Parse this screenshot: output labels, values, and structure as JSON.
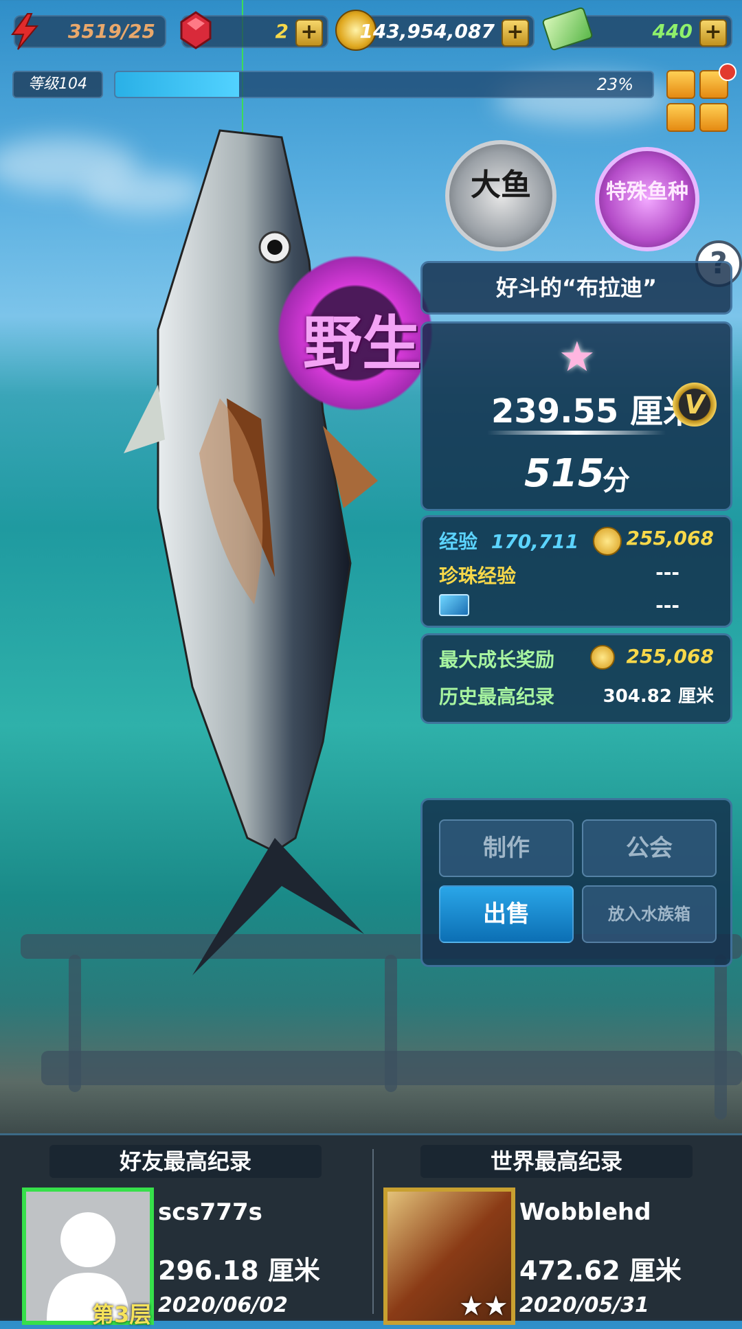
{
  "topbar": {
    "energy": "3519/25",
    "gems": "2",
    "coins": "143,954,087",
    "cash": "440",
    "plus_symbol": "+"
  },
  "level": {
    "label": "等级104",
    "progress_text": "23%",
    "progress_fraction": 0.23
  },
  "badges": {
    "big_fish": "大鱼",
    "special_species": "特殊鱼种",
    "help": "?"
  },
  "wild_label": "野生",
  "fish": {
    "name": "好斗的“布拉迪”",
    "size_value": "239.55",
    "size_unit": "厘米",
    "vip_letter": "V",
    "score_value": "515",
    "score_unit": "分"
  },
  "rewards": {
    "exp_label": "经验",
    "exp_value": "170,711",
    "coin_value": "255,068",
    "pearl_exp_label": "珍珠经验",
    "pearl_exp_value": "---",
    "ticket_value": "---"
  },
  "growth": {
    "max_bonus_label": "最大成长奖励",
    "max_bonus_value": "255,068",
    "record_label": "历史最高纪录",
    "record_value": "304.82 厘米"
  },
  "actions": {
    "craft": "制作",
    "guild": "公会",
    "sell": "出售",
    "aquarium": "放入水族箱"
  },
  "friends": {
    "title": "好友最高纪录",
    "player": "scs777s",
    "size": "296.18 厘米",
    "date": "2020/06/02",
    "floor": "第3层"
  },
  "world": {
    "title": "世界最高纪录",
    "player": "Wobblehd",
    "size": "472.62 厘米",
    "date": "2020/05/31",
    "stars": "★★"
  },
  "colors": {
    "gold": "#f7d84a",
    "cyan": "#5cd4ff",
    "friend_border": "#36e04a",
    "panel": "#142d4b"
  }
}
